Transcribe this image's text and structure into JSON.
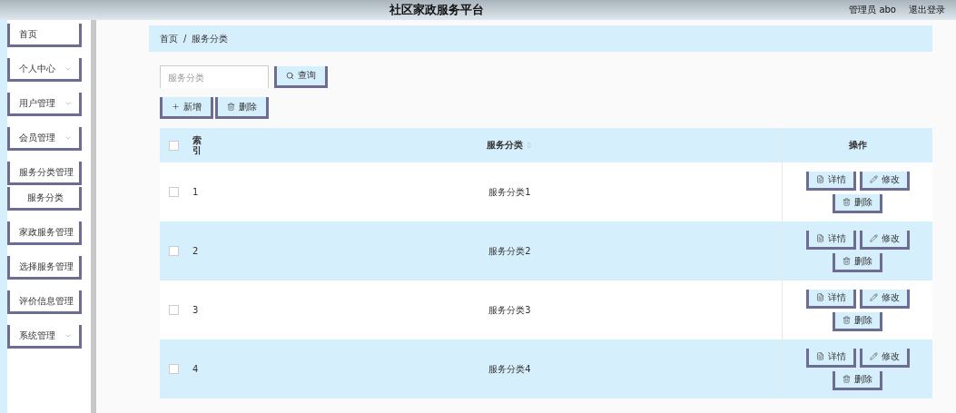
{
  "header": {
    "title": "社区家政服务平台",
    "user": "管理员 abo",
    "logout": "退出登录"
  },
  "sidebar": {
    "items": [
      {
        "kind": "link",
        "label": "首页"
      },
      {
        "kind": "menu",
        "label": "个人中心"
      },
      {
        "kind": "menu",
        "label": "用户管理"
      },
      {
        "kind": "menu",
        "label": "会员管理"
      },
      {
        "kind": "menu",
        "label": "服务分类管理",
        "children": [
          {
            "label": "服务分类"
          }
        ]
      },
      {
        "kind": "menu",
        "label": "家政服务管理"
      },
      {
        "kind": "menu",
        "label": "选择服务管理"
      },
      {
        "kind": "menu",
        "label": "评价信息管理"
      },
      {
        "kind": "menu",
        "label": "系统管理"
      }
    ]
  },
  "breadcrumb": {
    "separator": "/",
    "items": [
      "首页",
      "服务分类"
    ]
  },
  "search": {
    "placeholder": "服务分类",
    "button": "查询"
  },
  "actions": [
    {
      "kind": "add",
      "label": "新增"
    },
    {
      "kind": "delete",
      "label": "删除"
    }
  ],
  "table": {
    "select_all": {
      "checked": false
    },
    "columns": [
      {
        "label": "索引"
      },
      {
        "label": "服务分类",
        "sortable": true
      },
      {
        "label": "操作"
      }
    ],
    "rows": [
      {
        "checked": false,
        "index": "1",
        "name": "服务分类1",
        "actions": [
          {
            "kind": "detail",
            "label": "详情"
          },
          {
            "kind": "edit",
            "label": "修改"
          },
          {
            "kind": "delete",
            "label": "删除"
          }
        ]
      },
      {
        "checked": false,
        "index": "2",
        "name": "服务分类2",
        "actions": [
          {
            "kind": "detail",
            "label": "详情"
          },
          {
            "kind": "edit",
            "label": "修改"
          },
          {
            "kind": "delete",
            "label": "删除"
          }
        ]
      },
      {
        "checked": false,
        "index": "3",
        "name": "服务分类3",
        "actions": [
          {
            "kind": "detail",
            "label": "详情"
          },
          {
            "kind": "edit",
            "label": "修改"
          },
          {
            "kind": "delete",
            "label": "删除"
          }
        ]
      },
      {
        "checked": false,
        "index": "4",
        "name": "服务分类4",
        "actions": [
          {
            "kind": "detail",
            "label": "详情"
          },
          {
            "kind": "edit",
            "label": "修改"
          },
          {
            "kind": "delete",
            "label": "删除"
          }
        ]
      }
    ]
  }
}
